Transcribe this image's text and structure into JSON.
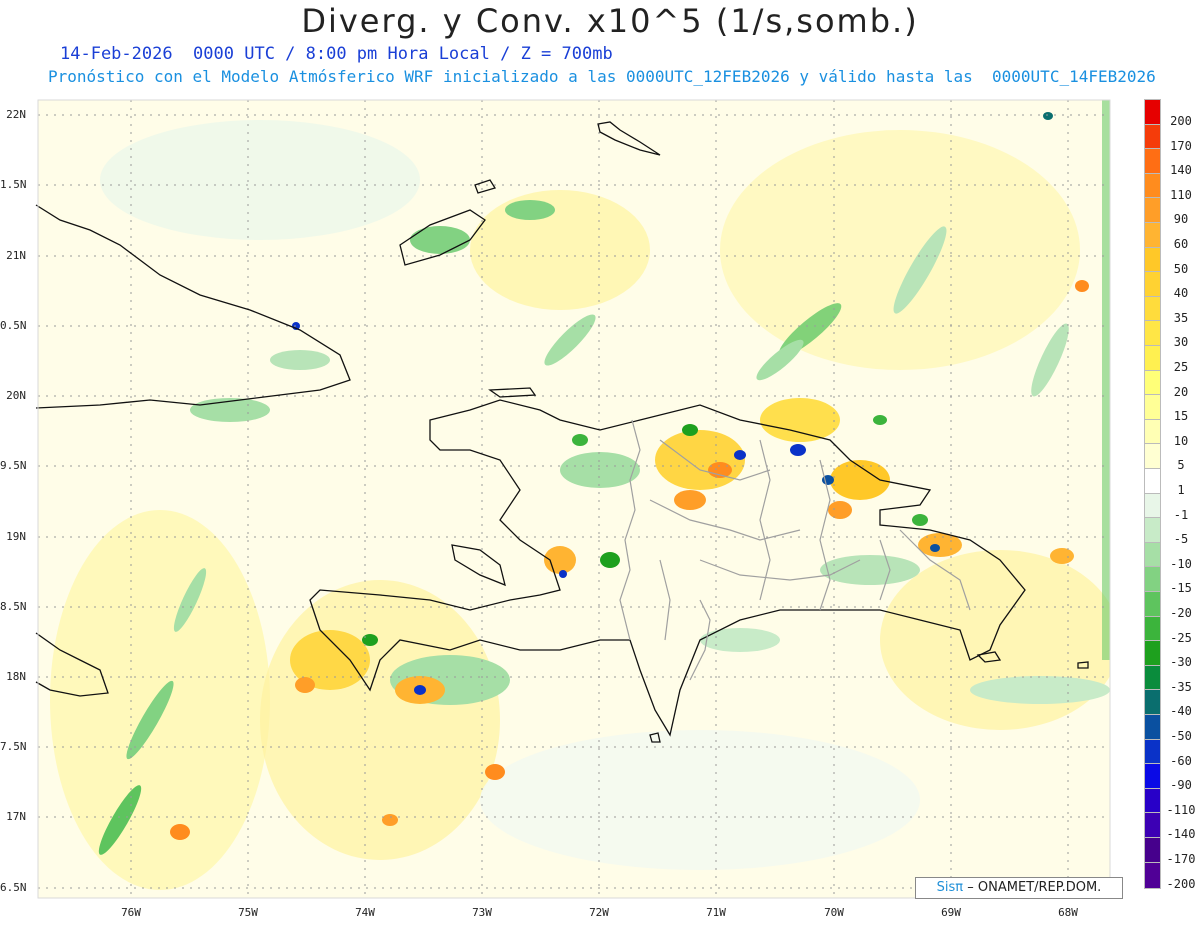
{
  "title": "Diverg. y Conv. x10^5 (1/s,somb.)",
  "subtitle_time": "14-Feb-2026  0000 UTC / 8:00 pm Hora Local / Z = 700mb",
  "subtitle_model": "Pronóstico con el Modelo Atmósferico WRF inicializado a las 0000UTC_12FEB2026 y válido hasta las  0000UTC_14FEB2026",
  "lat_labels": [
    "22N",
    "1.5N",
    "21N",
    "0.5N",
    "20N",
    "9.5N",
    "19N",
    "8.5N",
    "18N",
    "7.5N",
    "17N",
    "6.5N"
  ],
  "lon_labels": [
    "76W",
    "75W",
    "74W",
    "73W",
    "72W",
    "71W",
    "70W",
    "69W",
    "68W"
  ],
  "colorbar": {
    "labels": [
      "200",
      "170",
      "140",
      "110",
      "90",
      "60",
      "50",
      "40",
      "35",
      "30",
      "25",
      "20",
      "15",
      "10",
      "5",
      "1",
      "-1",
      "-5",
      "-10",
      "-15",
      "-20",
      "-25",
      "-30",
      "-35",
      "-40",
      "-50",
      "-60",
      "-90",
      "-110",
      "-140",
      "-170",
      "-200"
    ],
    "colors": [
      "#e60000",
      "#f53c0a",
      "#ff6e14",
      "#ff8c1e",
      "#ff9e28",
      "#ffb432",
      "#ffc828",
      "#ffd232",
      "#ffdc3c",
      "#ffe646",
      "#fff050",
      "#ffff78",
      "#ffff96",
      "#ffffb4",
      "#ffffd2",
      "#ffffff",
      "#e8f6e8",
      "#c8ebc8",
      "#a6dfa6",
      "#82d282",
      "#5ec45e",
      "#3cb43c",
      "#1ea01e",
      "#0a8c3c",
      "#0a6e6e",
      "#0a50a0",
      "#0a32c8",
      "#0a0ae6",
      "#2800c8",
      "#3c00b4",
      "#46008c",
      "#500096"
    ]
  },
  "credit": {
    "logo": "Sisπ",
    "text": "– ONAMET/REP.DOM."
  }
}
